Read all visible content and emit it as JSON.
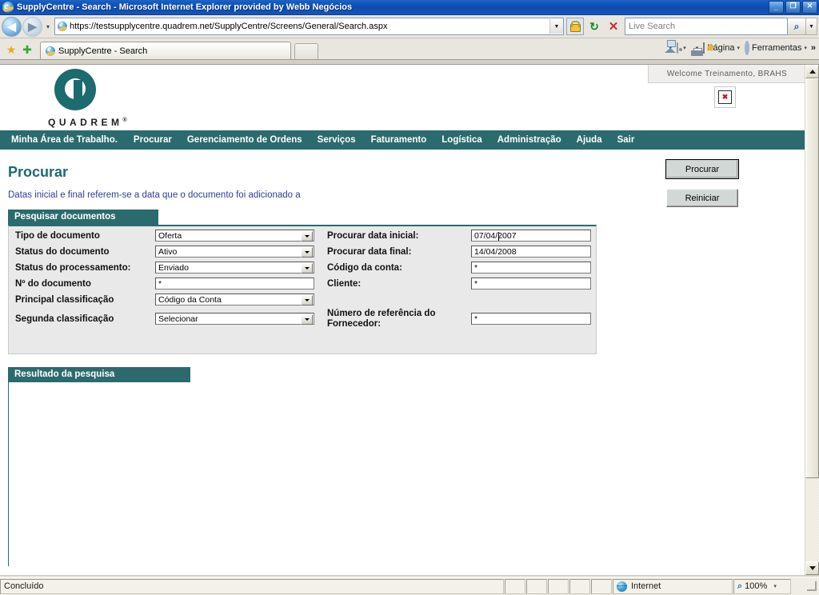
{
  "window": {
    "title": "SupplyCentre - Search - Microsoft Internet Explorer provided by Webb Negócios",
    "minimize_label": "_",
    "restore_label": "❐",
    "close_label": "✕"
  },
  "browser": {
    "back_label": "◀",
    "forward_label": "▶",
    "history_label": "▾",
    "url": "https://testsupplycentre.quadrem.net/SupplyCentre/Screens/General/Search.aspx",
    "url_drop_label": "▼",
    "lock_icon": "lock-icon",
    "refresh_label": "↻",
    "stop_label": "✕",
    "search_placeholder": "Live Search",
    "search_go_label": "⌕",
    "search_drop_label": "▼",
    "favorites_star_label": "★",
    "favorites_add_label": "✚",
    "tab_label": "SupplyCentre - Search",
    "commands": [
      {
        "name": "home",
        "label": "",
        "caret": "▾"
      },
      {
        "name": "feeds",
        "label": "",
        "caret": "▾"
      },
      {
        "name": "print",
        "label": "",
        "caret": "▾"
      },
      {
        "name": "page",
        "label": "Página",
        "caret": "▾"
      },
      {
        "name": "tools",
        "label": "Ferramentas",
        "caret": "▾"
      }
    ],
    "overflow_label": "»"
  },
  "app": {
    "welcome": "Welcome  Treinamento, BRAHS",
    "logo_word": "QUADREM",
    "logo_reg": "®",
    "broken_image_label": "✖",
    "nav": [
      "Minha Área de Trabalho.",
      "Procurar",
      "Gerenciamento de Ordens",
      "Serviços",
      "Faturamento",
      "Logística",
      "Administração",
      "Ajuda",
      "Sair"
    ],
    "page_title": "Procurar",
    "page_subtitle": "Datas inicial e final referem-se a data que o documento foi adicionado a",
    "search_panel": {
      "header": "Pesquisar documentos",
      "left_fields": [
        {
          "label": "Tipo de documento",
          "value": "Oferta",
          "type": "select"
        },
        {
          "label": "Status do documento",
          "value": "Ativo",
          "type": "select"
        },
        {
          "label": "Status do processamento:",
          "value": "Enviado",
          "type": "select"
        },
        {
          "label": "Nº do documento",
          "value": "*",
          "type": "text"
        },
        {
          "label": "Principal classificação",
          "value": "Código da Conta",
          "type": "select"
        },
        {
          "label": "Segunda classificação",
          "value": "Selecionar",
          "type": "select"
        }
      ],
      "right_fields": [
        {
          "label": "Procurar data inicial:",
          "value": "07/04/2007",
          "type": "text"
        },
        {
          "label": "Procurar data final:",
          "value": "14/04/2008",
          "type": "text"
        },
        {
          "label": "Código da conta:",
          "value": "*",
          "type": "text"
        },
        {
          "label": "Cliente:",
          "value": "*",
          "type": "text"
        },
        {
          "label": "Número de referência do Fornecedor:",
          "value": "*",
          "type": "text"
        }
      ],
      "submit_label": "Procurar",
      "reset_label": "Reiniciar"
    },
    "results": {
      "header": "Resultado da pesquisa"
    },
    "theme": {
      "teal": "#2b6b6e",
      "link_blue": "#2c3e9e",
      "panel_gray": "#e9e9e9"
    }
  },
  "statusbar": {
    "status": "Concluído",
    "zone": "Internet",
    "zoom": "100%",
    "zoom_caret": "▾"
  }
}
